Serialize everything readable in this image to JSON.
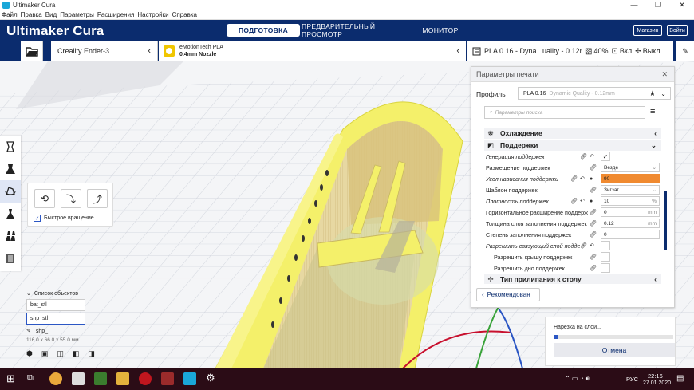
{
  "window": {
    "title": "Ultimaker Cura",
    "minimize": "—",
    "maximize": "❐",
    "close": "✕"
  },
  "menu": [
    "Файл",
    "Правка",
    "Вид",
    "Параметры",
    "Расширения",
    "Настройки",
    "Справка"
  ],
  "header": {
    "brand": "Ultimaker Cura",
    "tabs": [
      "ПОДГОТОВКА",
      "ПРЕДВАРИТЕЛЬНЫЙ ПРОСМОТР",
      "МОНИТОР"
    ],
    "active_tab": 0,
    "store_label": "Магазин",
    "login_label": "Войти"
  },
  "toolbar": {
    "printer": "Creality Ender-3",
    "material_name": "eMotionTech PLA",
    "nozzle": "0.4mm Nozzle",
    "profile_summary": "PLA 0.16 - Dyna...uality - 0.12mm",
    "infill": "40%",
    "support": "Вкл",
    "adhesion": "Выкл"
  },
  "tools": [
    "move-tool",
    "scale-tool",
    "rotate-tool",
    "mirror-tool",
    "per-model-settings-tool",
    "support-blocker-tool"
  ],
  "rotate_panel": {
    "quick_rotate_label": "Быстрое вращение",
    "quick_rotate_checked": true
  },
  "object_list": {
    "title": "Список объектов",
    "items": [
      "bat_stl",
      "shp_stl"
    ],
    "selected_name": "shp_",
    "dimensions": "116.0 x 66.0 x 55.0 мм"
  },
  "settings_panel": {
    "title": "Параметры печати",
    "profile_label": "Профиль",
    "profile_value": "PLA 0.16",
    "profile_hint": "Dynamic Quality - 0.12mm",
    "search_placeholder": "Параметры поиска",
    "sections": [
      {
        "label": "Охлаждение",
        "collapsed": true
      },
      {
        "label": "Поддержки",
        "collapsed": false
      }
    ],
    "rows": [
      {
        "label": "Генерация поддержек",
        "value": "✓",
        "unit": "",
        "italic": true
      },
      {
        "label": "Размещение поддержек",
        "value": "Везде",
        "unit": "",
        "italic": false
      },
      {
        "label": "Угол нависания поддержки",
        "value": "90",
        "unit": "",
        "italic": true,
        "highlight": true
      },
      {
        "label": "Шаблон поддержек",
        "value": "Зигзаг",
        "unit": "",
        "italic": false
      },
      {
        "label": "Плотность поддержек",
        "value": "10",
        "unit": "%",
        "italic": true
      },
      {
        "label": "Горизонтальное расширение поддержки",
        "value": "0",
        "unit": "mm",
        "italic": false
      },
      {
        "label": "Толщина слоя заполнения поддержек",
        "value": "0.12",
        "unit": "mm",
        "italic": false
      },
      {
        "label": "Степень заполнения поддержек",
        "value": "0",
        "unit": "",
        "italic": false
      },
      {
        "label": "Разрешить связующий слой поддержки",
        "value": "",
        "unit": "",
        "italic": true
      },
      {
        "label": "Разрешить крышу поддержек",
        "value": "",
        "unit": "",
        "italic": false
      },
      {
        "label": "Разрешить дно поддержек",
        "value": "",
        "unit": "",
        "italic": false
      }
    ],
    "adhesion_section": "Тип прилипания к столу",
    "recommended_button": "Рекомендован"
  },
  "slice_panel": {
    "status": "Нарезка на слои...",
    "progress": 0.03,
    "cancel_label": "Отмена"
  },
  "taskbar": {
    "lang": "РУС",
    "time": "22:16",
    "date": "27.01.2020"
  },
  "colors": {
    "header": "#0b2c6e",
    "model_yellow": "#f4f06a",
    "highlight": "#f08a30",
    "taskbar": "#2b0c16"
  }
}
